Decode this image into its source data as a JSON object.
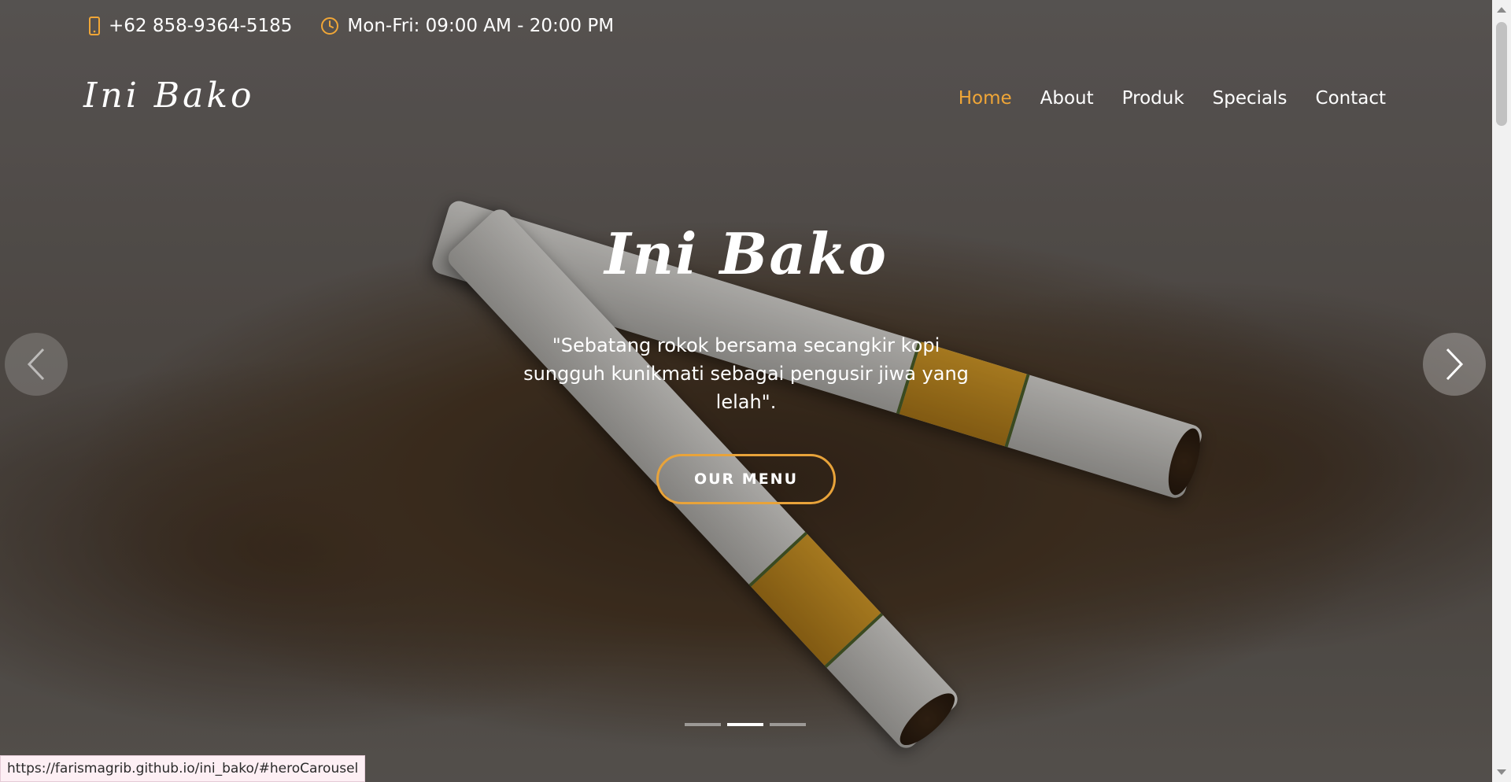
{
  "topbar": {
    "phone": "+62 858-9364-5185",
    "hours": "Mon-Fri: 09:00 AM - 20:00 PM",
    "phone_icon": "mobile-phone-icon",
    "hours_icon": "clock-icon"
  },
  "header": {
    "logo": "Ini Bako",
    "nav": [
      {
        "label": "Home",
        "active": true
      },
      {
        "label": "About"
      },
      {
        "label": "Produk"
      },
      {
        "label": "Specials"
      },
      {
        "label": "Contact"
      }
    ]
  },
  "hero": {
    "title": "Ini Bako",
    "quote": "\"Sebatang rokok bersama secangkir kopi sungguh kunikmati sebagai pengusir jiwa yang lelah\".",
    "button": "OUR MENU",
    "prev_icon": "chevron-left-icon",
    "next_icon": "chevron-right-icon",
    "slides_total": 3,
    "active_slide": 2
  },
  "statusbar": {
    "url": "https://farismagrib.github.io/ini_bako/#heroCarousel"
  },
  "colors": {
    "accent": "#f0a637",
    "button_border": "#e8a33a",
    "text": "#ffffff"
  }
}
